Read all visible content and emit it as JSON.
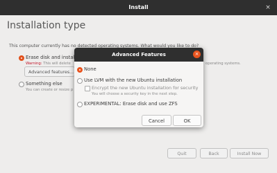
{
  "window": {
    "title": "Install",
    "close_glyph": "×"
  },
  "page": {
    "title": "Installation type",
    "question": "This computer currently has no detected operating systems. What would you like to do?"
  },
  "options": {
    "erase": {
      "label": "Erase disk and install",
      "warning_label": "Warning:",
      "warning_text": " This will delete",
      "side_text": "operating systems.",
      "advanced_button": "Advanced features..."
    },
    "something_else": {
      "label": "Something else",
      "hint": "You can create or resize p"
    }
  },
  "footer": {
    "quit": "Quit",
    "back": "Back",
    "install_now": "Install Now"
  },
  "dialog": {
    "title": "Advanced Features",
    "close_glyph": "×",
    "options": {
      "none": "None",
      "lvm": "Use LVM with the new Ubuntu installation",
      "encrypt": "Encrypt the new Ubuntu installation for security",
      "encrypt_hint": "You will choose a security key in the next step.",
      "zfs": "EXPERIMENTAL: Erase disk and use ZFS"
    },
    "cancel": "Cancel",
    "ok": "OK"
  },
  "colors": {
    "accent": "#e9541e",
    "titlebar": "#2f2f2f",
    "warning": "#c7162b"
  }
}
